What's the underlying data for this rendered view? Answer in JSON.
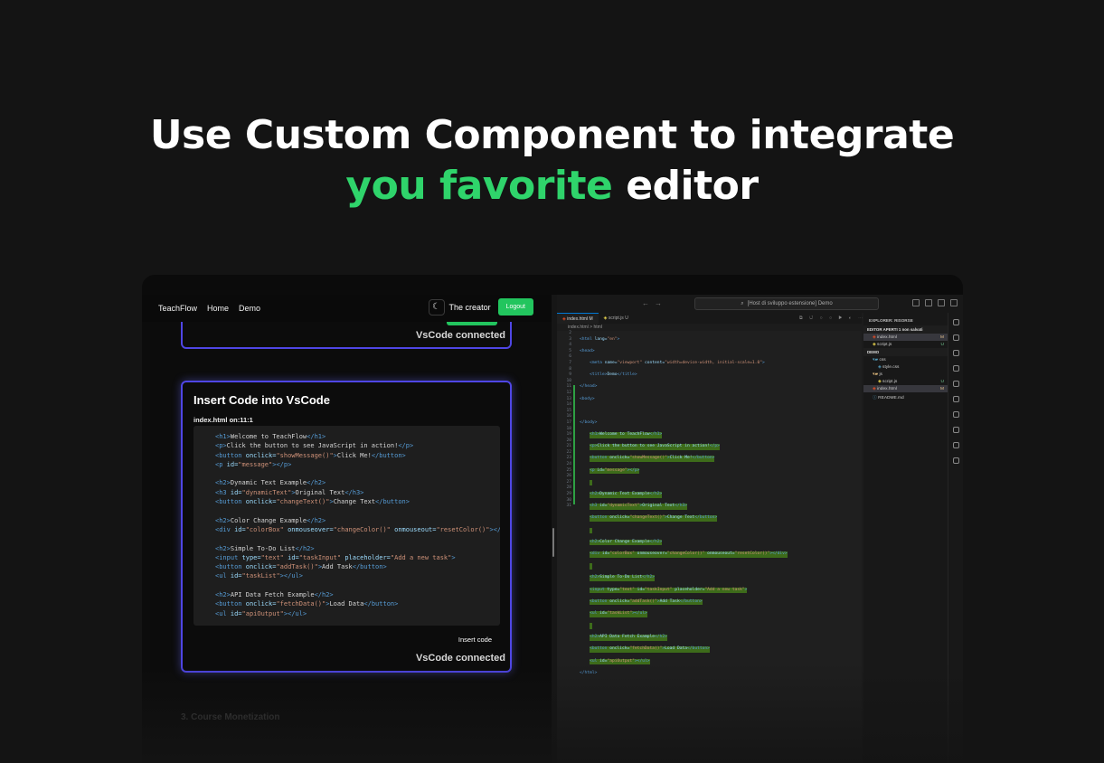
{
  "hero": {
    "line1": "Use Custom Component to integrate",
    "accent": "you favorite",
    "tail": "editor"
  },
  "app": {
    "nav": {
      "brand": "TeachFlow",
      "home": "Home",
      "demo": "Demo",
      "creator": "The creator",
      "logout": "Logout",
      "theme_icon": "moon-icon"
    },
    "card": {
      "title": "Insert Code into VsCode",
      "file": "index.html on:11:1",
      "insert": "Insert code",
      "connected": "VsCode connected"
    },
    "card_top": {
      "connected": "VsCode connected"
    },
    "next_section": "3. Course Monetization"
  },
  "vscode": {
    "command_center": "[Host di sviluppo estensione] Demo",
    "tabs": [
      {
        "label": "index.html",
        "badge": "M"
      },
      {
        "label": "script.js",
        "badge": "U"
      }
    ],
    "breadcrumb": "index.html > html",
    "explorer": {
      "title": "EXPLORER: RISORSE",
      "open_editors": "EDITOR APERTI",
      "unsaved": "1 non salvati",
      "demo": "DEMO",
      "items": [
        {
          "label": "index.html",
          "badge": "M",
          "section": "open"
        },
        {
          "label": "script.js",
          "badge": "U",
          "section": "open"
        },
        {
          "label": "css",
          "badge": "",
          "section": "demo"
        },
        {
          "label": "style.css",
          "badge": "",
          "section": "demo"
        },
        {
          "label": "js",
          "badge": "",
          "section": "demo"
        },
        {
          "label": "script.js",
          "badge": "U",
          "section": "demo"
        },
        {
          "label": "index.html",
          "badge": "M",
          "section": "demo"
        },
        {
          "label": "README.md",
          "badge": "",
          "section": "demo"
        }
      ]
    }
  }
}
